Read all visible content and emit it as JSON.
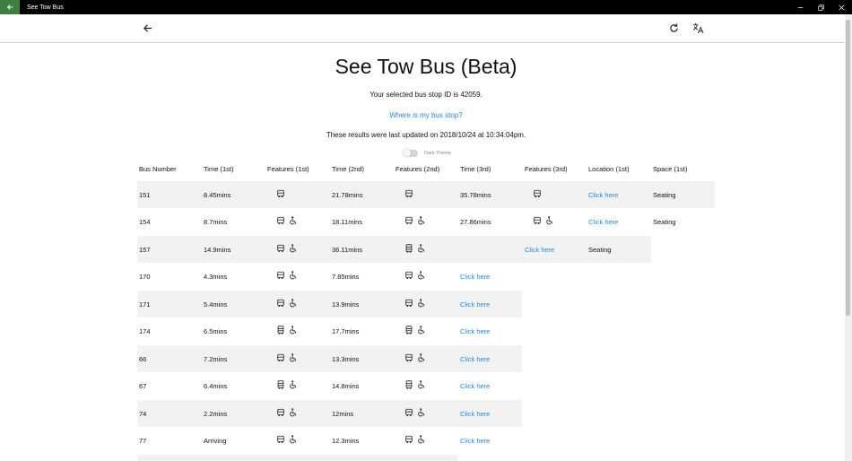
{
  "window": {
    "title": "See Tow Bus"
  },
  "page": {
    "title": "See Tow Bus (Beta)",
    "stop_text": "Your selected bus stop ID is 42059.",
    "where_link": "Where is my bus stop?",
    "updated_text": "These results were last updated on 2018/10/24 at 10:34:04pm.",
    "dark_theme_label": "Dark Theme"
  },
  "table": {
    "headers": [
      "Bus Number",
      "Time (1st)",
      "Features (1st)",
      "Time (2nd)",
      "Features (2nd)",
      "Time (3rd)",
      "Features (3rd)",
      "Location (1st)",
      "Space (1st)"
    ],
    "rows": [
      {
        "bus": "151",
        "t1": "8.45mins",
        "f1": [
          "bus"
        ],
        "t2": "21.78mins",
        "f2": [
          "bus"
        ],
        "t3": "35.78mins",
        "f3": [
          "bus"
        ],
        "loc": "Click here",
        "space": "Seating"
      },
      {
        "bus": "154",
        "t1": "8.7mins",
        "f1": [
          "bus",
          "wheelchair"
        ],
        "t2": "18.11mins",
        "f2": [
          "bus",
          "wheelchair"
        ],
        "t3": "27.86mins",
        "f3": [
          "bus",
          "wheelchair"
        ],
        "loc": "Click here",
        "space": "Seating"
      },
      {
        "bus": "157",
        "t1": "14.9mins",
        "f1": [
          "bus",
          "wheelchair"
        ],
        "t2": "36.11mins",
        "f2": [
          "double-decker",
          "wheelchair"
        ],
        "t3": "",
        "f3": [],
        "loc": "Click here",
        "space": "Seating"
      },
      {
        "bus": "170",
        "t1": "4.3mins",
        "f1": [
          "bus",
          "wheelchair"
        ],
        "t2": "7.85mins",
        "f2": [
          "bus",
          "wheelchair"
        ],
        "t3": "Click here",
        "f3": [],
        "loc": "",
        "space": ""
      },
      {
        "bus": "171",
        "t1": "5.4mins",
        "f1": [
          "bus",
          "wheelchair"
        ],
        "t2": "13.9mins",
        "f2": [
          "bus",
          "wheelchair"
        ],
        "t3": "Click here",
        "f3": [],
        "loc": "",
        "space": ""
      },
      {
        "bus": "174",
        "t1": "6.5mins",
        "f1": [
          "double-decker",
          "wheelchair"
        ],
        "t2": "17.7mins",
        "f2": [
          "double-decker",
          "wheelchair"
        ],
        "t3": "Click here",
        "f3": [],
        "loc": "",
        "space": ""
      },
      {
        "bus": "66",
        "t1": "7.2mins",
        "f1": [
          "bus",
          "wheelchair"
        ],
        "t2": "13.3mins",
        "f2": [
          "bus",
          "wheelchair"
        ],
        "t3": "Click here",
        "f3": [],
        "loc": "",
        "space": ""
      },
      {
        "bus": "67",
        "t1": "6.4mins",
        "f1": [
          "double-decker",
          "wheelchair"
        ],
        "t2": "14.8mins",
        "f2": [
          "double-decker",
          "wheelchair"
        ],
        "t3": "Click here",
        "f3": [],
        "loc": "",
        "space": ""
      },
      {
        "bus": "74",
        "t1": "2.2mins",
        "f1": [
          "bus",
          "wheelchair"
        ],
        "t2": "12mins",
        "f2": [
          "bus",
          "wheelchair"
        ],
        "t3": "Click here",
        "f3": [],
        "loc": "",
        "space": ""
      },
      {
        "bus": "77",
        "t1": "Arriving",
        "f1": [
          "bus",
          "wheelchair"
        ],
        "t2": "12.3mins",
        "f2": [
          "bus",
          "wheelchair"
        ],
        "t3": "Click here",
        "f3": [],
        "loc": "",
        "space": ""
      }
    ]
  },
  "colors": {
    "link": "#1e88e5",
    "row_shade": "#f2f2f2",
    "titlebar": "#000000",
    "back_button": "#3f7f3f"
  }
}
